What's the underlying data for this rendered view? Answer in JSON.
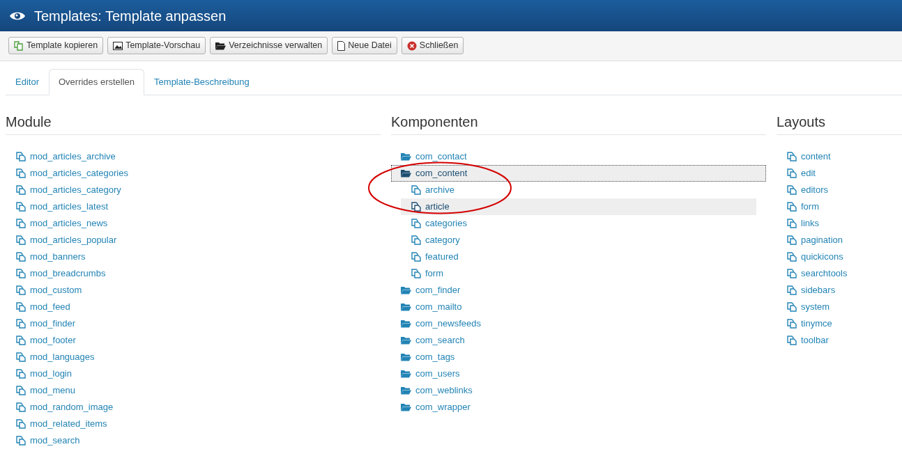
{
  "header": {
    "title": "Templates: Template anpassen"
  },
  "toolbar": [
    {
      "kind": "copy",
      "label": "Template kopieren"
    },
    {
      "kind": "preview",
      "label": "Template-Vorschau"
    },
    {
      "kind": "folder",
      "label": "Verzeichnisse verwalten"
    },
    {
      "kind": "file",
      "label": "Neue Datei"
    },
    {
      "kind": "close",
      "label": "Schließen"
    }
  ],
  "tabs": [
    {
      "label": "Editor",
      "selected": false
    },
    {
      "label": "Overrides erstellen",
      "selected": true
    },
    {
      "label": "Template-Beschreibung",
      "selected": false
    }
  ],
  "modules": {
    "title": "Module",
    "items": [
      "mod_articles_archive",
      "mod_articles_categories",
      "mod_articles_category",
      "mod_articles_latest",
      "mod_articles_news",
      "mod_articles_popular",
      "mod_banners",
      "mod_breadcrumbs",
      "mod_custom",
      "mod_feed",
      "mod_finder",
      "mod_footer",
      "mod_languages",
      "mod_login",
      "mod_menu",
      "mod_random_image",
      "mod_related_items",
      "mod_search"
    ]
  },
  "components": {
    "title": "Komponenten",
    "items": [
      {
        "label": "com_contact",
        "selected": false,
        "focused": false
      },
      {
        "label": "com_content",
        "selected": true,
        "focused": true,
        "children": [
          {
            "label": "archive",
            "selected": false
          },
          {
            "label": "article",
            "selected": true
          },
          {
            "label": "categories",
            "selected": false
          },
          {
            "label": "category",
            "selected": false
          },
          {
            "label": "featured",
            "selected": false
          },
          {
            "label": "form",
            "selected": false
          }
        ]
      },
      {
        "label": "com_finder",
        "selected": false,
        "focused": false
      },
      {
        "label": "com_mailto",
        "selected": false,
        "focused": false
      },
      {
        "label": "com_newsfeeds",
        "selected": false,
        "focused": false
      },
      {
        "label": "com_search",
        "selected": false,
        "focused": false
      },
      {
        "label": "com_tags",
        "selected": false,
        "focused": false
      },
      {
        "label": "com_users",
        "selected": false,
        "focused": false
      },
      {
        "label": "com_weblinks",
        "selected": false,
        "focused": false
      },
      {
        "label": "com_wrapper",
        "selected": false,
        "focused": false
      }
    ]
  },
  "layouts": {
    "title": "Layouts",
    "items": [
      "content",
      "edit",
      "editors",
      "form",
      "links",
      "pagination",
      "quickicons",
      "searchtools",
      "sidebars",
      "system",
      "tinymce",
      "toolbar"
    ]
  },
  "annotations": [
    {
      "kind": "ellipse"
    }
  ]
}
